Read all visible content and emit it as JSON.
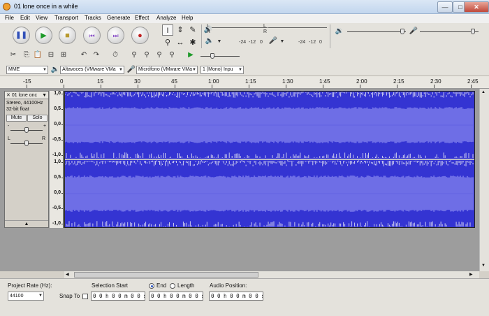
{
  "window": {
    "title": "01 lone once in a while",
    "minimize": "—",
    "maximize": "□",
    "close": "✕"
  },
  "menu": [
    "File",
    "Edit",
    "View",
    "Transport",
    "Tracks",
    "Generate",
    "Effect",
    "Analyze",
    "Help"
  ],
  "meters": {
    "left": "L",
    "right": "R",
    "db_a": "-24",
    "db_b": "-12",
    "db_c": "0"
  },
  "device": {
    "host": "MME",
    "output": "Altavoces (VMware VMa",
    "input": "Micrófono (VMware VMa",
    "channels": "1 (Mono) Inpu"
  },
  "ruler": [
    "-15",
    "0",
    "15",
    "30",
    "45",
    "1:00",
    "1:15",
    "1:30",
    "1:45",
    "2:00",
    "2:15",
    "2:30",
    "2:45"
  ],
  "track": {
    "name": "01 lone onc",
    "info1": "Stereo, 44100Hz",
    "info2": "32-bit float",
    "mute": "Mute",
    "solo": "Solo",
    "pan_left": "L",
    "pan_right": "R",
    "minus": "-",
    "plus": "+",
    "collapse": "▲"
  },
  "vaxis": [
    "1,0",
    "0,5",
    "0,0",
    "-0,5",
    "-1,0"
  ],
  "selection": {
    "project_rate_label": "Project Rate (Hz):",
    "project_rate": "44100",
    "snap_to": "Snap To",
    "selection_start": "Selection Start",
    "end": "End",
    "length": "Length",
    "audio_position": "Audio Position:",
    "time_start": "0 0 h 0 0 m 0 0 s",
    "time_end": "0 0 h 0 0 m 0 0 s",
    "time_audio": "0 0 h 0 0 m 0 0 s"
  },
  "colors": {
    "wave_bg": "#3434d2",
    "wave_rms": "#6e6ee6",
    "wave_peak": "#e8e8f4"
  }
}
